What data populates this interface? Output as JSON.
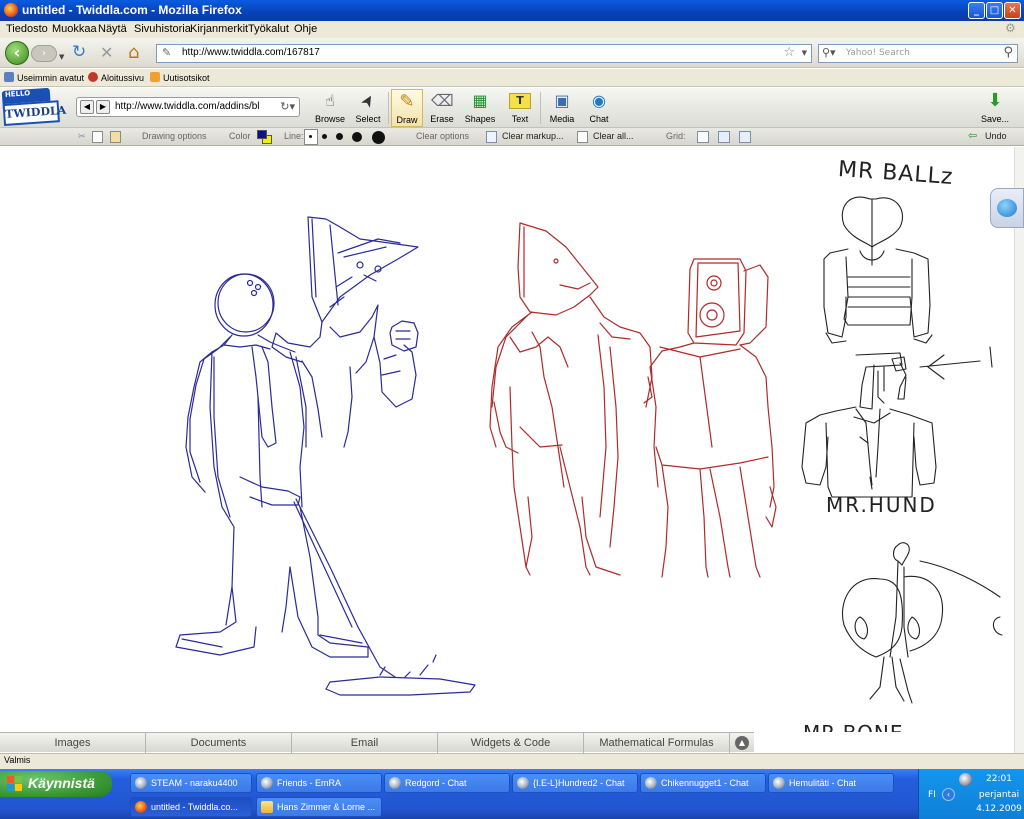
{
  "window": {
    "title": "untitled - Twiddla.com - Mozilla Firefox",
    "min": "_",
    "max": "□",
    "close": "✕"
  },
  "menu": [
    "Tiedosto",
    "Muokkaa",
    "Näytä",
    "Sivuhistoria",
    "Kirjanmerkit",
    "Työkalut",
    "Ohje"
  ],
  "nav": {
    "back": "‹",
    "forward": "›",
    "reload": "↻",
    "stop": "✕",
    "home": "⌂",
    "url": "http://www.twiddla.com/167817",
    "search_placeholder": "Yahoo! Search"
  },
  "bookmarks": [
    {
      "label": "Useimmin avatut",
      "color": "#5c7fbf"
    },
    {
      "label": "Aloitussivu",
      "color": "#c0392b"
    },
    {
      "label": "Uutisotsikot",
      "color": "#f0a030"
    }
  ],
  "twiddla": {
    "logo_top": "HELLO",
    "logo_main": "TWIDDLA",
    "url": "http://www.twiddla.com/addins/bl",
    "tools": [
      {
        "label": "Browse",
        "icon": "☝"
      },
      {
        "label": "Select",
        "icon": "➤"
      },
      {
        "label": "Draw",
        "icon": "✎"
      },
      {
        "label": "Erase",
        "icon": "⌫"
      },
      {
        "label": "Shapes",
        "icon": "▦"
      },
      {
        "label": "Text",
        "icon": "T"
      },
      {
        "label": "Media",
        "icon": "▣"
      },
      {
        "label": "Chat",
        "icon": "◉"
      }
    ],
    "save": "Save...",
    "options": {
      "drawing_options": "Drawing options",
      "color": "Color",
      "line": "Line:",
      "clear_options": "Clear options",
      "clear_markup": "Clear markup...",
      "clear_all": "Clear all...",
      "grid": "Grid:",
      "undo": "Undo"
    }
  },
  "canvas_labels": {
    "mr_ballz": "MR BALLz",
    "mr_hund": "MR.HUND",
    "mr_bone": "MR.BONE"
  },
  "bottom_tabs": [
    "Images",
    "Documents",
    "Email",
    "Widgets & Code",
    "Mathematical Formulas"
  ],
  "status": "Valmis",
  "taskbar": {
    "start": "Käynnistä",
    "tasks_row1": [
      "STEAM - naraku4400",
      "Friends - EmRA",
      "Redgord - Chat",
      "{I.E-L}Hundred2 - Chat",
      "Chikennugget1 - Chat",
      "Hemulitäti - Chat"
    ],
    "tasks_row2": [
      "untitled - Twiddla.co...",
      "Hans Zimmer & Lorne ..."
    ],
    "lang": "FI",
    "time": "22:01",
    "day": "perjantai",
    "date": "4.12.2009"
  },
  "colors": {
    "blue_ink": "#2a2a9a",
    "red_ink": "#b02a2a",
    "black_ink": "#222222"
  }
}
